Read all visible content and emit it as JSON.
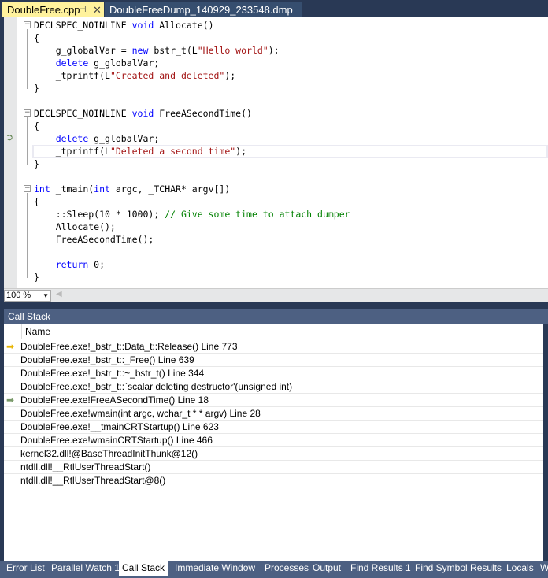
{
  "tabs": [
    {
      "label": "DoubleFree.cpp",
      "active": true
    },
    {
      "label": "DoubleFreeDump_140929_233548.dmp",
      "active": false
    }
  ],
  "code": [
    [
      [
        "DECLSPEC_NOINLINE ",
        ""
      ],
      [
        "void",
        "kw"
      ],
      [
        " Allocate()",
        ""
      ]
    ],
    [
      [
        "{",
        ""
      ]
    ],
    [
      [
        "    g_globalVar = ",
        ""
      ],
      [
        "new",
        "kw"
      ],
      [
        " bstr_t(L",
        ""
      ],
      [
        "\"Hello world\"",
        "str"
      ],
      [
        ");",
        ""
      ]
    ],
    [
      [
        "    ",
        ""
      ],
      [
        "delete",
        "kw"
      ],
      [
        " g_globalVar;",
        ""
      ]
    ],
    [
      [
        "    _tprintf(L",
        ""
      ],
      [
        "\"Created and deleted\"",
        "str"
      ],
      [
        ");",
        ""
      ]
    ],
    [
      [
        "}",
        ""
      ]
    ],
    [],
    [
      [
        "DECLSPEC_NOINLINE ",
        ""
      ],
      [
        "void",
        "kw"
      ],
      [
        " FreeASecondTime()",
        ""
      ]
    ],
    [
      [
        "{",
        ""
      ]
    ],
    [
      [
        "    ",
        ""
      ],
      [
        "delete",
        "kw"
      ],
      [
        " g_globalVar;",
        ""
      ]
    ],
    [
      [
        "    _tprintf(L",
        ""
      ],
      [
        "\"Deleted a second time\"",
        "str"
      ],
      [
        ");",
        ""
      ]
    ],
    [
      [
        "}",
        ""
      ]
    ],
    [],
    [
      [
        "int",
        "kw"
      ],
      [
        " _tmain(",
        ""
      ],
      [
        "int",
        "kw"
      ],
      [
        " argc, _TCHAR* argv[])",
        ""
      ]
    ],
    [
      [
        "{",
        ""
      ]
    ],
    [
      [
        "    ::Sleep(10 * 1000); ",
        ""
      ],
      [
        "// Give some time to attach dumper",
        "cm"
      ]
    ],
    [
      [
        "    Allocate();",
        ""
      ]
    ],
    [
      [
        "    FreeASecondTime();",
        ""
      ]
    ],
    [],
    [
      [
        "    ",
        ""
      ],
      [
        "return",
        "kw"
      ],
      [
        " 0;",
        ""
      ]
    ],
    [
      [
        "}",
        ""
      ]
    ]
  ],
  "zoom": "100 %",
  "callstack": {
    "title": "Call Stack",
    "column": "Name",
    "rows": [
      {
        "name": "DoubleFree.exe!_bstr_t::Data_t::Release() Line 773",
        "icon": "current"
      },
      {
        "name": "DoubleFree.exe!_bstr_t::_Free() Line 639"
      },
      {
        "name": "DoubleFree.exe!_bstr_t::~_bstr_t() Line 344"
      },
      {
        "name": "DoubleFree.exe!_bstr_t::`scalar deleting destructor'(unsigned int)"
      },
      {
        "name": "DoubleFree.exe!FreeASecondTime() Line 18",
        "icon": "return"
      },
      {
        "name": "DoubleFree.exe!wmain(int argc, wchar_t * * argv) Line 28"
      },
      {
        "name": "DoubleFree.exe!__tmainCRTStartup() Line 623"
      },
      {
        "name": "DoubleFree.exe!wmainCRTStartup() Line 466"
      },
      {
        "name": "kernel32.dll!@BaseThreadInitThunk@12()"
      },
      {
        "name": "ntdll.dll!__RtlUserThreadStart()"
      },
      {
        "name": "ntdll.dll!__RtlUserThreadStart@8()"
      }
    ]
  },
  "bottom_tabs": [
    "Error List",
    "Parallel Watch 1",
    "Call Stack",
    "Immediate Window",
    "Processes",
    "Output",
    "Find Results 1",
    "Find Symbol Results",
    "Locals",
    "W"
  ],
  "active_bottom_tab": "Call Stack",
  "colors": {
    "active_tab": "#fff29d",
    "frame": "#293955",
    "panel": "#4d6082"
  }
}
